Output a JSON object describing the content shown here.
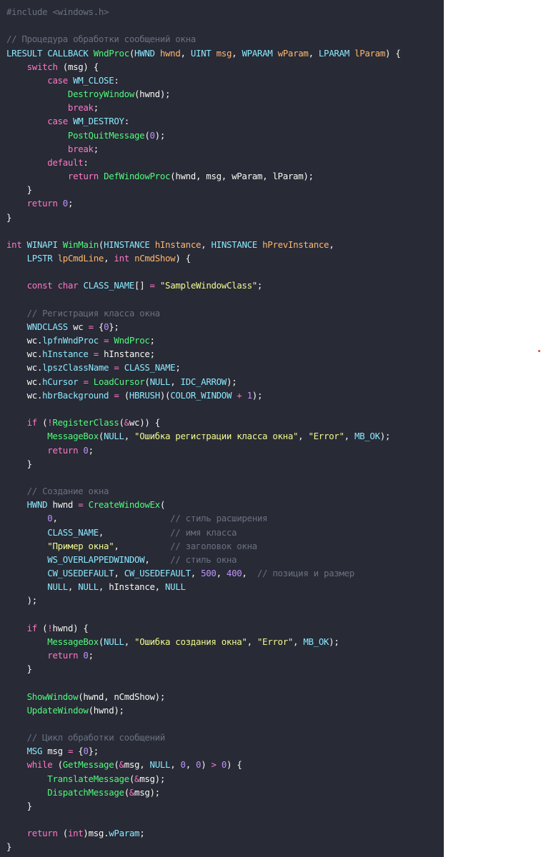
{
  "theme": {
    "editor_background": "#282a36",
    "page_background": "#ffffff",
    "comment": "#6b7180",
    "keyword": "#ff79c6",
    "type": "#8be9fd",
    "function": "#50fa7b",
    "string": "#f1fa8c",
    "number": "#bd93f9",
    "parameter": "#ffb86c",
    "text": "#f8f8f2",
    "marker_dot": "#e0452f"
  },
  "code": {
    "language": "c",
    "lines": [
      [
        [
          "pp",
          "#include <windows.h>"
        ]
      ],
      [],
      [
        [
          "cm",
          "// Процедура обработки сообщений окна"
        ]
      ],
      [
        [
          "ty",
          "LRESULT"
        ],
        [
          "p",
          " "
        ],
        [
          "ty",
          "CALLBACK"
        ],
        [
          "p",
          " "
        ],
        [
          "fn",
          "WndProc"
        ],
        [
          "p",
          "("
        ],
        [
          "ty",
          "HWND"
        ],
        [
          "p",
          " "
        ],
        [
          "pa",
          "hwnd"
        ],
        [
          "p",
          ", "
        ],
        [
          "ty",
          "UINT"
        ],
        [
          "p",
          " "
        ],
        [
          "pa",
          "msg"
        ],
        [
          "p",
          ", "
        ],
        [
          "ty",
          "WPARAM"
        ],
        [
          "p",
          " "
        ],
        [
          "pa",
          "wParam"
        ],
        [
          "p",
          ", "
        ],
        [
          "ty",
          "LPARAM"
        ],
        [
          "p",
          " "
        ],
        [
          "pa",
          "lParam"
        ],
        [
          "p",
          ") {"
        ]
      ],
      [
        [
          "p",
          "    "
        ],
        [
          "kw",
          "switch"
        ],
        [
          "p",
          " ("
        ],
        [
          "id",
          "msg"
        ],
        [
          "p",
          ") {"
        ]
      ],
      [
        [
          "p",
          "        "
        ],
        [
          "kw",
          "case"
        ],
        [
          "p",
          " "
        ],
        [
          "mac",
          "WM_CLOSE"
        ],
        [
          "p",
          ":"
        ]
      ],
      [
        [
          "p",
          "            "
        ],
        [
          "fn",
          "DestroyWindow"
        ],
        [
          "p",
          "("
        ],
        [
          "id",
          "hwnd"
        ],
        [
          "p",
          ");"
        ]
      ],
      [
        [
          "p",
          "            "
        ],
        [
          "kw",
          "break"
        ],
        [
          "p",
          ";"
        ]
      ],
      [
        [
          "p",
          "        "
        ],
        [
          "kw",
          "case"
        ],
        [
          "p",
          " "
        ],
        [
          "mac",
          "WM_DESTROY"
        ],
        [
          "p",
          ":"
        ]
      ],
      [
        [
          "p",
          "            "
        ],
        [
          "fn",
          "PostQuitMessage"
        ],
        [
          "p",
          "("
        ],
        [
          "num",
          "0"
        ],
        [
          "p",
          ");"
        ]
      ],
      [
        [
          "p",
          "            "
        ],
        [
          "kw",
          "break"
        ],
        [
          "p",
          ";"
        ]
      ],
      [
        [
          "p",
          "        "
        ],
        [
          "kw",
          "default"
        ],
        [
          "p",
          ":"
        ]
      ],
      [
        [
          "p",
          "            "
        ],
        [
          "kw",
          "return"
        ],
        [
          "p",
          " "
        ],
        [
          "fn",
          "DefWindowProc"
        ],
        [
          "p",
          "("
        ],
        [
          "id",
          "hwnd"
        ],
        [
          "p",
          ", "
        ],
        [
          "id",
          "msg"
        ],
        [
          "p",
          ", "
        ],
        [
          "id",
          "wParam"
        ],
        [
          "p",
          ", "
        ],
        [
          "id",
          "lParam"
        ],
        [
          "p",
          ");"
        ]
      ],
      [
        [
          "p",
          "    }"
        ]
      ],
      [
        [
          "p",
          "    "
        ],
        [
          "kw",
          "return"
        ],
        [
          "p",
          " "
        ],
        [
          "num",
          "0"
        ],
        [
          "p",
          ";"
        ]
      ],
      [
        [
          "p",
          "}"
        ]
      ],
      [],
      [
        [
          "kw",
          "int"
        ],
        [
          "p",
          " "
        ],
        [
          "ty",
          "WINAPI"
        ],
        [
          "p",
          " "
        ],
        [
          "fn",
          "WinMain"
        ],
        [
          "p",
          "("
        ],
        [
          "ty",
          "HINSTANCE"
        ],
        [
          "p",
          " "
        ],
        [
          "pa",
          "hInstance"
        ],
        [
          "p",
          ", "
        ],
        [
          "ty",
          "HINSTANCE"
        ],
        [
          "p",
          " "
        ],
        [
          "pa",
          "hPrevInstance"
        ],
        [
          "p",
          ","
        ]
      ],
      [
        [
          "p",
          "    "
        ],
        [
          "ty",
          "LPSTR"
        ],
        [
          "p",
          " "
        ],
        [
          "pa",
          "lpCmdLine"
        ],
        [
          "p",
          ", "
        ],
        [
          "kw",
          "int"
        ],
        [
          "p",
          " "
        ],
        [
          "pa",
          "nCmdShow"
        ],
        [
          "p",
          ") {"
        ]
      ],
      [],
      [
        [
          "p",
          "    "
        ],
        [
          "kw",
          "const"
        ],
        [
          "p",
          " "
        ],
        [
          "kw",
          "char"
        ],
        [
          "p",
          " "
        ],
        [
          "mac",
          "CLASS_NAME"
        ],
        [
          "p",
          "[] "
        ],
        [
          "op",
          "="
        ],
        [
          "p",
          " "
        ],
        [
          "str",
          "\"SampleWindowClass\""
        ],
        [
          "p",
          ";"
        ]
      ],
      [],
      [
        [
          "p",
          "    "
        ],
        [
          "cm",
          "// Регистрация класса окна"
        ]
      ],
      [
        [
          "p",
          "    "
        ],
        [
          "ty",
          "WNDCLASS"
        ],
        [
          "p",
          " "
        ],
        [
          "id",
          "wc"
        ],
        [
          "p",
          " "
        ],
        [
          "op",
          "="
        ],
        [
          "p",
          " {"
        ],
        [
          "num",
          "0"
        ],
        [
          "p",
          "};"
        ]
      ],
      [
        [
          "p",
          "    "
        ],
        [
          "id",
          "wc"
        ],
        [
          "p",
          "."
        ],
        [
          "fld",
          "lpfnWndProc"
        ],
        [
          "p",
          " "
        ],
        [
          "op",
          "="
        ],
        [
          "p",
          " "
        ],
        [
          "fn",
          "WndProc"
        ],
        [
          "p",
          ";"
        ]
      ],
      [
        [
          "p",
          "    "
        ],
        [
          "id",
          "wc"
        ],
        [
          "p",
          "."
        ],
        [
          "fld",
          "hInstance"
        ],
        [
          "p",
          " "
        ],
        [
          "op",
          "="
        ],
        [
          "p",
          " "
        ],
        [
          "id",
          "hInstance"
        ],
        [
          "p",
          ";"
        ]
      ],
      [
        [
          "p",
          "    "
        ],
        [
          "id",
          "wc"
        ],
        [
          "p",
          "."
        ],
        [
          "fld",
          "lpszClassName"
        ],
        [
          "p",
          " "
        ],
        [
          "op",
          "="
        ],
        [
          "p",
          " "
        ],
        [
          "mac",
          "CLASS_NAME"
        ],
        [
          "p",
          ";"
        ]
      ],
      [
        [
          "p",
          "    "
        ],
        [
          "id",
          "wc"
        ],
        [
          "p",
          "."
        ],
        [
          "fld",
          "hCursor"
        ],
        [
          "p",
          " "
        ],
        [
          "op",
          "="
        ],
        [
          "p",
          " "
        ],
        [
          "fn",
          "LoadCursor"
        ],
        [
          "p",
          "("
        ],
        [
          "mac",
          "NULL"
        ],
        [
          "p",
          ", "
        ],
        [
          "mac",
          "IDC_ARROW"
        ],
        [
          "p",
          ");"
        ]
      ],
      [
        [
          "p",
          "    "
        ],
        [
          "id",
          "wc"
        ],
        [
          "p",
          "."
        ],
        [
          "fld",
          "hbrBackground"
        ],
        [
          "p",
          " "
        ],
        [
          "op",
          "="
        ],
        [
          "p",
          " ("
        ],
        [
          "ty",
          "HBRUSH"
        ],
        [
          "p",
          ")("
        ],
        [
          "mac",
          "COLOR_WINDOW"
        ],
        [
          "p",
          " "
        ],
        [
          "op",
          "+"
        ],
        [
          "p",
          " "
        ],
        [
          "num",
          "1"
        ],
        [
          "p",
          ");"
        ]
      ],
      [],
      [
        [
          "p",
          "    "
        ],
        [
          "kw",
          "if"
        ],
        [
          "p",
          " ("
        ],
        [
          "op",
          "!"
        ],
        [
          "fn",
          "RegisterClass"
        ],
        [
          "p",
          "("
        ],
        [
          "op",
          "&"
        ],
        [
          "id",
          "wc"
        ],
        [
          "p",
          ")) {"
        ]
      ],
      [
        [
          "p",
          "        "
        ],
        [
          "fn",
          "MessageBox"
        ],
        [
          "p",
          "("
        ],
        [
          "mac",
          "NULL"
        ],
        [
          "p",
          ", "
        ],
        [
          "str",
          "\"Ошибка регистрации класса окна\""
        ],
        [
          "p",
          ", "
        ],
        [
          "str",
          "\"Error\""
        ],
        [
          "p",
          ", "
        ],
        [
          "mac",
          "MB_OK"
        ],
        [
          "p",
          ");"
        ]
      ],
      [
        [
          "p",
          "        "
        ],
        [
          "kw",
          "return"
        ],
        [
          "p",
          " "
        ],
        [
          "num",
          "0"
        ],
        [
          "p",
          ";"
        ]
      ],
      [
        [
          "p",
          "    }"
        ]
      ],
      [],
      [
        [
          "p",
          "    "
        ],
        [
          "cm",
          "// Создание окна"
        ]
      ],
      [
        [
          "p",
          "    "
        ],
        [
          "ty",
          "HWND"
        ],
        [
          "p",
          " "
        ],
        [
          "id",
          "hwnd"
        ],
        [
          "p",
          " "
        ],
        [
          "op",
          "="
        ],
        [
          "p",
          " "
        ],
        [
          "fn",
          "CreateWindowEx"
        ],
        [
          "p",
          "("
        ]
      ],
      [
        [
          "p",
          "        "
        ],
        [
          "num",
          "0"
        ],
        [
          "p",
          ",                      "
        ],
        [
          "cm",
          "// стиль расширения"
        ]
      ],
      [
        [
          "p",
          "        "
        ],
        [
          "mac",
          "CLASS_NAME"
        ],
        [
          "p",
          ",             "
        ],
        [
          "cm",
          "// имя класса"
        ]
      ],
      [
        [
          "p",
          "        "
        ],
        [
          "str",
          "\"Пример окна\""
        ],
        [
          "p",
          ",          "
        ],
        [
          "cm",
          "// заголовок окна"
        ]
      ],
      [
        [
          "p",
          "        "
        ],
        [
          "mac",
          "WS_OVERLAPPEDWINDOW"
        ],
        [
          "p",
          ",    "
        ],
        [
          "cm",
          "// стиль окна"
        ]
      ],
      [
        [
          "p",
          "        "
        ],
        [
          "mac",
          "CW_USEDEFAULT"
        ],
        [
          "p",
          ", "
        ],
        [
          "mac",
          "CW_USEDEFAULT"
        ],
        [
          "p",
          ", "
        ],
        [
          "num",
          "500"
        ],
        [
          "p",
          ", "
        ],
        [
          "num",
          "400"
        ],
        [
          "p",
          ",  "
        ],
        [
          "cm",
          "// позиция и размер"
        ]
      ],
      [
        [
          "p",
          "        "
        ],
        [
          "mac",
          "NULL"
        ],
        [
          "p",
          ", "
        ],
        [
          "mac",
          "NULL"
        ],
        [
          "p",
          ", "
        ],
        [
          "id",
          "hInstance"
        ],
        [
          "p",
          ", "
        ],
        [
          "mac",
          "NULL"
        ]
      ],
      [
        [
          "p",
          "    );"
        ]
      ],
      [],
      [
        [
          "p",
          "    "
        ],
        [
          "kw",
          "if"
        ],
        [
          "p",
          " ("
        ],
        [
          "op",
          "!"
        ],
        [
          "id",
          "hwnd"
        ],
        [
          "p",
          ") {"
        ]
      ],
      [
        [
          "p",
          "        "
        ],
        [
          "fn",
          "MessageBox"
        ],
        [
          "p",
          "("
        ],
        [
          "mac",
          "NULL"
        ],
        [
          "p",
          ", "
        ],
        [
          "str",
          "\"Ошибка создания окна\""
        ],
        [
          "p",
          ", "
        ],
        [
          "str",
          "\"Error\""
        ],
        [
          "p",
          ", "
        ],
        [
          "mac",
          "MB_OK"
        ],
        [
          "p",
          ");"
        ]
      ],
      [
        [
          "p",
          "        "
        ],
        [
          "kw",
          "return"
        ],
        [
          "p",
          " "
        ],
        [
          "num",
          "0"
        ],
        [
          "p",
          ";"
        ]
      ],
      [
        [
          "p",
          "    }"
        ]
      ],
      [],
      [
        [
          "p",
          "    "
        ],
        [
          "fn",
          "ShowWindow"
        ],
        [
          "p",
          "("
        ],
        [
          "id",
          "hwnd"
        ],
        [
          "p",
          ", "
        ],
        [
          "id",
          "nCmdShow"
        ],
        [
          "p",
          ");"
        ]
      ],
      [
        [
          "p",
          "    "
        ],
        [
          "fn",
          "UpdateWindow"
        ],
        [
          "p",
          "("
        ],
        [
          "id",
          "hwnd"
        ],
        [
          "p",
          ");"
        ]
      ],
      [],
      [
        [
          "p",
          "    "
        ],
        [
          "cm",
          "// Цикл обработки сообщений"
        ]
      ],
      [
        [
          "p",
          "    "
        ],
        [
          "ty",
          "MSG"
        ],
        [
          "p",
          " "
        ],
        [
          "id",
          "msg"
        ],
        [
          "p",
          " "
        ],
        [
          "op",
          "="
        ],
        [
          "p",
          " {"
        ],
        [
          "num",
          "0"
        ],
        [
          "p",
          "};"
        ]
      ],
      [
        [
          "p",
          "    "
        ],
        [
          "kw",
          "while"
        ],
        [
          "p",
          " ("
        ],
        [
          "fn",
          "GetMessage"
        ],
        [
          "p",
          "("
        ],
        [
          "op",
          "&"
        ],
        [
          "id",
          "msg"
        ],
        [
          "p",
          ", "
        ],
        [
          "mac",
          "NULL"
        ],
        [
          "p",
          ", "
        ],
        [
          "num",
          "0"
        ],
        [
          "p",
          ", "
        ],
        [
          "num",
          "0"
        ],
        [
          "p",
          ") "
        ],
        [
          "op",
          ">"
        ],
        [
          "p",
          " "
        ],
        [
          "num",
          "0"
        ],
        [
          "p",
          ") {"
        ]
      ],
      [
        [
          "p",
          "        "
        ],
        [
          "fn",
          "TranslateMessage"
        ],
        [
          "p",
          "("
        ],
        [
          "op",
          "&"
        ],
        [
          "id",
          "msg"
        ],
        [
          "p",
          ");"
        ]
      ],
      [
        [
          "p",
          "        "
        ],
        [
          "fn",
          "DispatchMessage"
        ],
        [
          "p",
          "("
        ],
        [
          "op",
          "&"
        ],
        [
          "id",
          "msg"
        ],
        [
          "p",
          ");"
        ]
      ],
      [
        [
          "p",
          "    }"
        ]
      ],
      [],
      [
        [
          "p",
          "    "
        ],
        [
          "kw",
          "return"
        ],
        [
          "p",
          " ("
        ],
        [
          "kw",
          "int"
        ],
        [
          "p",
          ")"
        ],
        [
          "id",
          "msg"
        ],
        [
          "p",
          "."
        ],
        [
          "fld",
          "wParam"
        ],
        [
          "p",
          ";"
        ]
      ],
      [
        [
          "p",
          "}"
        ]
      ]
    ]
  }
}
